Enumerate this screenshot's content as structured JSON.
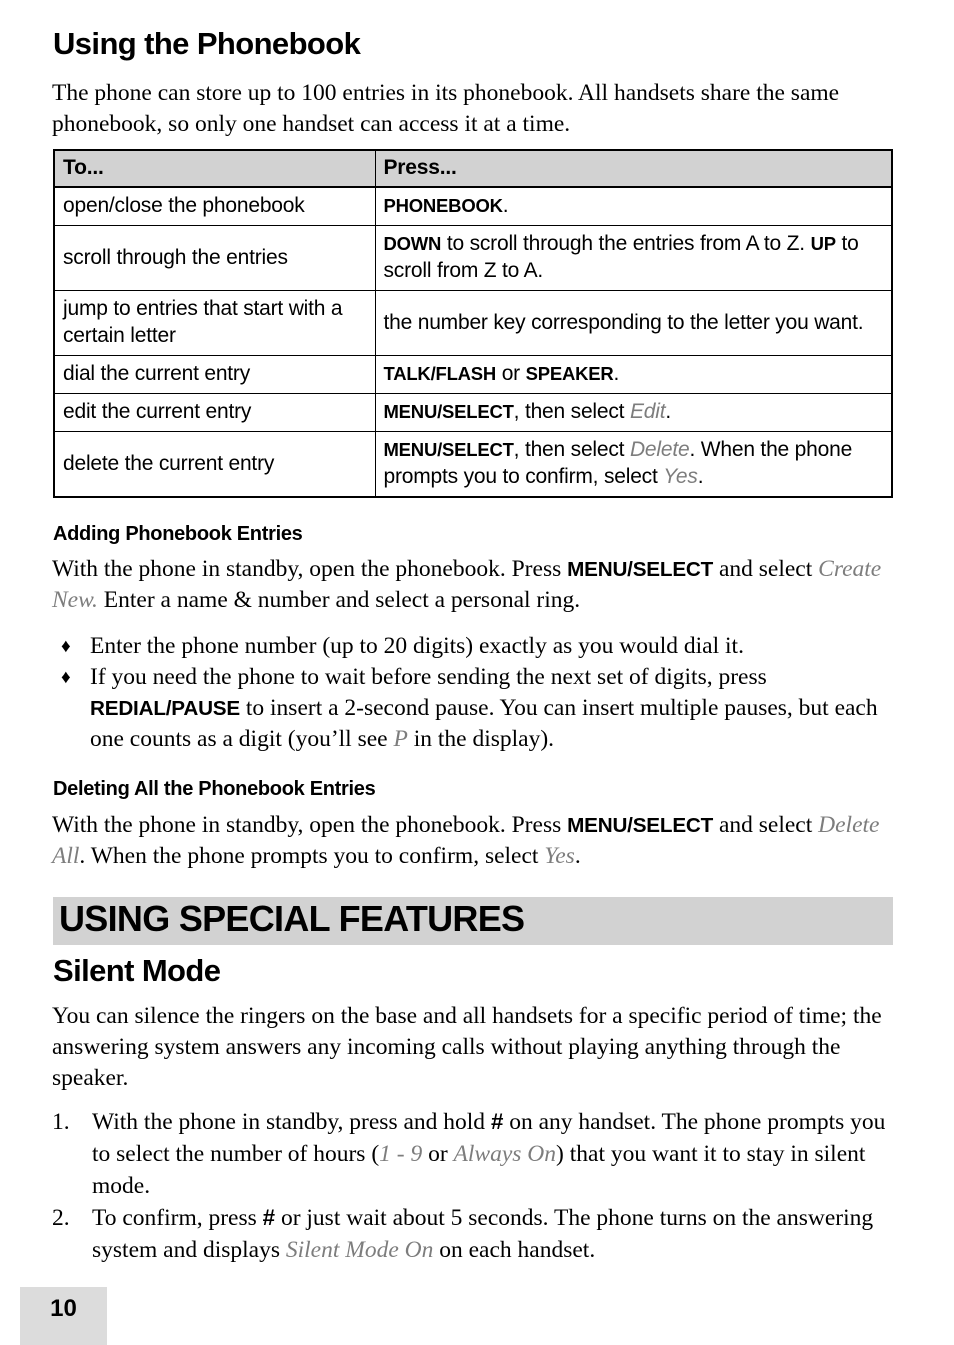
{
  "document": {
    "page_number": "10",
    "colors": {
      "banner_bg": "#d2d2d2",
      "table_header_bg": "#d2d2d2",
      "page_num_bg": "#dcdcdc",
      "ui_term_gray": "#7d7d7d",
      "text": "#000000"
    }
  },
  "phonebook_section": {
    "heading": "Using the Phonebook",
    "intro": "The phone can store up to 100 entries in its phonebook. All handsets share the same phonebook, so only one handset can access it at a time.",
    "table": {
      "headers": [
        "To...",
        "Press..."
      ],
      "rows": [
        {
          "to": "open/close the phonebook",
          "press_parts": [
            {
              "text": "PHONEBOOK",
              "style": "key"
            },
            {
              "text": ".",
              "style": "plain"
            }
          ]
        },
        {
          "to": "scroll through the entries",
          "press_parts": [
            {
              "text": "DOWN",
              "style": "key"
            },
            {
              "text": " to scroll through the entries from A to Z. ",
              "style": "plain"
            },
            {
              "text": "UP",
              "style": "key"
            },
            {
              "text": " to scroll from Z to A.",
              "style": "plain"
            }
          ]
        },
        {
          "to": "jump to entries that start with a certain letter",
          "press_parts": [
            {
              "text": "the number key corresponding to the letter you want.",
              "style": "plain"
            }
          ]
        },
        {
          "to": "dial the current entry",
          "press_parts": [
            {
              "text": "TALK/FLASH",
              "style": "key"
            },
            {
              "text": " or ",
              "style": "plain"
            },
            {
              "text": "SPEAKER",
              "style": "key"
            },
            {
              "text": ".",
              "style": "plain"
            }
          ]
        },
        {
          "to": "edit the current entry",
          "press_parts": [
            {
              "text": "MENU/SELECT",
              "style": "key"
            },
            {
              "text": ", then select ",
              "style": "plain"
            },
            {
              "text": "Edit",
              "style": "ui-term"
            },
            {
              "text": ".",
              "style": "plain"
            }
          ]
        },
        {
          "to": "delete the current entry",
          "press_parts": [
            {
              "text": "MENU/SELECT",
              "style": "key"
            },
            {
              "text": ", then select ",
              "style": "plain"
            },
            {
              "text": "Delete",
              "style": "ui-term"
            },
            {
              "text": ". When the phone prompts you to confirm, select ",
              "style": "plain"
            },
            {
              "text": "Yes",
              "style": "ui-term"
            },
            {
              "text": ".",
              "style": "plain"
            }
          ]
        }
      ]
    }
  },
  "adding_entries": {
    "heading": "Adding Phonebook Entries",
    "paragraph_parts": [
      {
        "text": "With the phone in standby, open the phonebook. Press ",
        "style": "plain"
      },
      {
        "text": "MENU/SELECT",
        "style": "key"
      },
      {
        "text": " and select ",
        "style": "plain"
      },
      {
        "text": "Create New.",
        "style": "ui-term-serif"
      },
      {
        "text": " Enter a name & number and select a personal ring.",
        "style": "plain"
      }
    ],
    "bullets": [
      {
        "marker": "♦",
        "parts": [
          {
            "text": "Enter the phone number (up to 20 digits) exactly as you would dial it.",
            "style": "plain"
          }
        ]
      },
      {
        "marker": "♦",
        "parts": [
          {
            "text": "If you need the phone to wait before sending the next set of digits, press ",
            "style": "plain"
          },
          {
            "text": "REDIAL/PAUSE",
            "style": "key"
          },
          {
            "text": " to insert a 2-second pause. You can insert multiple pauses, but each one counts as a digit (you’ll see ",
            "style": "plain"
          },
          {
            "text": "P",
            "style": "ui-term-serif"
          },
          {
            "text": " in the display).",
            "style": "plain"
          }
        ]
      }
    ]
  },
  "deleting_all": {
    "heading": "Deleting All the Phonebook Entries",
    "paragraph_parts": [
      {
        "text": "With the phone in standby, open the phonebook. Press ",
        "style": "plain"
      },
      {
        "text": "MENU/SELECT",
        "style": "key"
      },
      {
        "text": " and select ",
        "style": "plain"
      },
      {
        "text": "Delete All",
        "style": "ui-term-serif"
      },
      {
        "text": ". When the phone prompts you to confirm, select ",
        "style": "plain"
      },
      {
        "text": "Yes",
        "style": "ui-term-serif"
      },
      {
        "text": ".",
        "style": "plain"
      }
    ]
  },
  "special_features": {
    "banner_title": "USING SPECIAL FEATURES",
    "silent_mode": {
      "heading": "Silent Mode",
      "intro": "You can silence the ringers on the base and all handsets for a specific period of time; the answering system answers any incoming calls without playing anything through the speaker.",
      "steps": [
        {
          "number": "1.",
          "parts": [
            {
              "text": "With the phone in standby, press and hold ",
              "style": "plain"
            },
            {
              "text": "#",
              "style": "hashkey"
            },
            {
              "text": " on any handset. The phone prompts you to select the number of hours (",
              "style": "plain"
            },
            {
              "text": "1 - 9",
              "style": "ui-term-serif"
            },
            {
              "text": " or ",
              "style": "plain"
            },
            {
              "text": "Always On",
              "style": "ui-term-serif"
            },
            {
              "text": ") that you want it to stay in silent mode.",
              "style": "plain"
            }
          ]
        },
        {
          "number": "2.",
          "parts": [
            {
              "text": "To confirm, press ",
              "style": "plain"
            },
            {
              "text": "#",
              "style": "hashkey"
            },
            {
              "text": " or just wait about 5 seconds. The phone turns on the answering system and displays ",
              "style": "plain"
            },
            {
              "text": "Silent Mode On",
              "style": "ui-term-serif"
            },
            {
              "text": " on each handset.",
              "style": "plain"
            }
          ]
        }
      ]
    }
  }
}
